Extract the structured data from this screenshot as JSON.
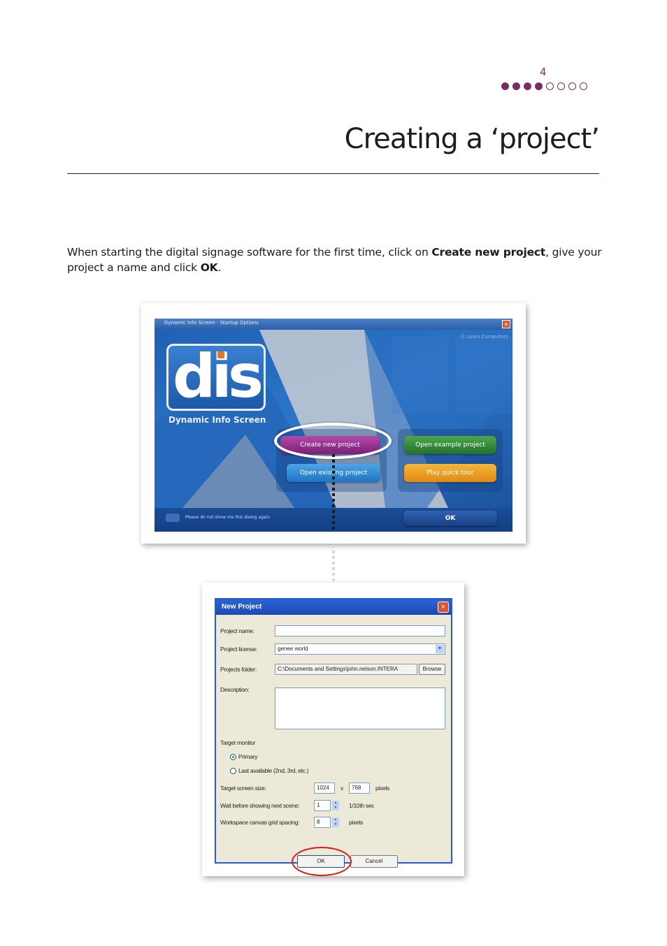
{
  "page": {
    "number": "4",
    "progress": {
      "filled": 4,
      "total": 8
    },
    "title": "Creating a ‘project’",
    "intro_parts": [
      "When starting the digital signage software for the first time, click on ",
      "Create new project",
      ", give your project a name and click ",
      "OK",
      "."
    ]
  },
  "startup_dialog": {
    "window_title": "Dynamic Info Screen - Startup Options",
    "corner_text": "© Lears Computers",
    "logo_text": "dis",
    "logo_caption": "Dynamic Info Screen",
    "buttons": {
      "create_new": "Create new project",
      "open_example": "Open example project",
      "open_existing": "Open existing project",
      "play_tour": "Play quick tour",
      "ok": "OK"
    },
    "dont_show": "Please do not show me this dialog again"
  },
  "new_project_dialog": {
    "window_title": "New Project",
    "labels": {
      "project_name": "Project name:",
      "project_license": "Project license:",
      "projects_folder": "Projects folder:",
      "description": "Description:",
      "target_monitor": "Target monitor",
      "primary": "Primary",
      "last_available": "Last available (2nd, 3rd, etc.)",
      "target_screen_size": "Target screen size:",
      "x": "x",
      "pixels": "pixels",
      "wait_before": "Wait before showing next scene:",
      "tenth_sec": "1/10th sec",
      "grid_spacing": "Workspace canvas grid spacing:",
      "pixels2": "pixels"
    },
    "values": {
      "project_name": "",
      "project_license": "genee world",
      "projects_folder": "C:\\Documents and Settings\\john.nelson.INTERA",
      "description": "",
      "width": "1024",
      "height": "768",
      "wait": "1",
      "grid": "8"
    },
    "buttons": {
      "browse": "Browse",
      "ok": "OK",
      "cancel": "Cancel"
    }
  }
}
